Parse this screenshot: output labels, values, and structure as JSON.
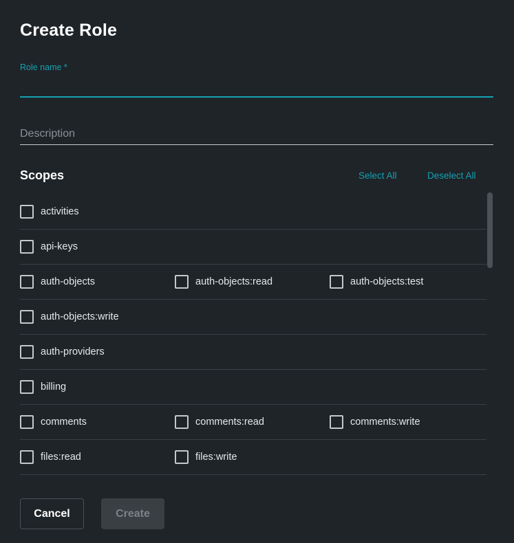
{
  "dialog": {
    "title": "Create Role",
    "role_name_label": "Role name *",
    "role_name_value": "",
    "description_placeholder": "Description",
    "description_value": ""
  },
  "scopes": {
    "title": "Scopes",
    "select_all_label": "Select All",
    "deselect_all_label": "Deselect All",
    "rows": [
      [
        "activities"
      ],
      [
        "api-keys"
      ],
      [
        "auth-objects",
        "auth-objects:read",
        "auth-objects:test"
      ],
      [
        "auth-objects:write"
      ],
      [
        "auth-providers"
      ],
      [
        "billing"
      ],
      [
        "comments",
        "comments:read",
        "comments:write"
      ],
      [
        "files:read",
        "files:write"
      ],
      []
    ]
  },
  "footer": {
    "cancel_label": "Cancel",
    "create_label": "Create"
  },
  "colors": {
    "background": "#1f2428",
    "accent": "#14a1b3",
    "disabled_button_bg": "#3a3f44",
    "disabled_button_text": "#7c8287"
  },
  "icons": {
    "checkbox": "checkbox-unchecked-icon"
  }
}
